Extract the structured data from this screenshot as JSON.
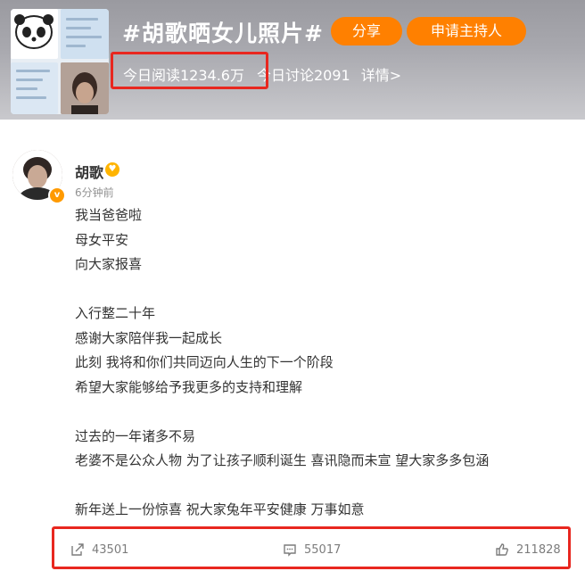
{
  "topic": {
    "title": "#胡歌晒女儿照片#",
    "share_label": "分享",
    "host_label": "申请主持人",
    "read_today": "今日阅读1234.6万",
    "discuss_today": "今日讨论2091",
    "details": "详情>"
  },
  "post": {
    "author": "胡歌",
    "time": "6分钟前",
    "lines": [
      "我当爸爸啦",
      "母女平安",
      "向大家报喜",
      "",
      "入行整二十年",
      "感谢大家陪伴我一起成长",
      "此刻 我将和你们共同迈向人生的下一个阶段",
      "希望大家能够给予我更多的支持和理解",
      "",
      "过去的一年诸多不易",
      "老婆不是公众人物 为了让孩子顺利诞生 喜讯隐而未宣 望大家多多包涵",
      "",
      "新年送上一份惊喜 祝大家兔年平安健康 万事如意"
    ]
  },
  "actions": {
    "repost_count": "43501",
    "comment_count": "55017",
    "like_count": "211828"
  },
  "colors": {
    "accent": "#ff8000",
    "highlight_box": "#e8271f"
  }
}
